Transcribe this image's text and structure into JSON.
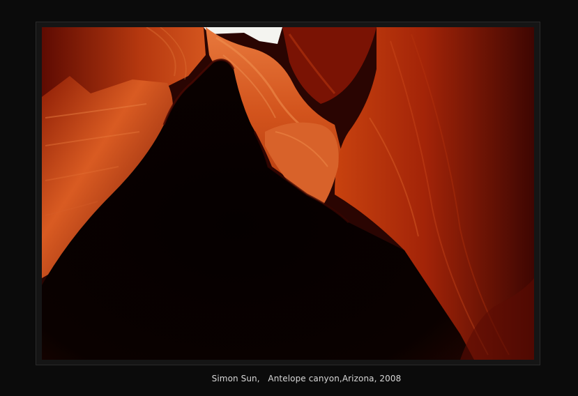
{
  "caption": "Simon Sun,   Antelope canyon,Arizona, 2008",
  "colors": {
    "frame": "#0b0b0b",
    "mat": "#151515",
    "rock_bright": "#e2652a",
    "rock_mid": "#b9320f",
    "rock_dark": "#5a0a02",
    "shadow": "#060101",
    "sky": "#f4f4f0"
  }
}
